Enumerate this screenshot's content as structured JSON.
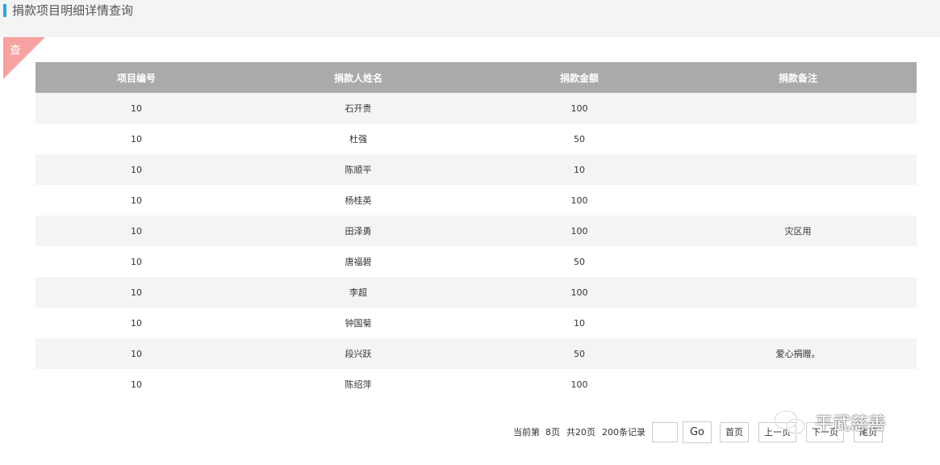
{
  "header": {
    "title": "捐款项目明细详情查询"
  },
  "panel": {
    "corner_label": "查"
  },
  "table": {
    "columns": [
      "项目编号",
      "捐款人姓名",
      "捐款金额",
      "捐款备注"
    ],
    "rows": [
      [
        "10",
        "石开贵",
        "100",
        ""
      ],
      [
        "10",
        "杜强",
        "50",
        ""
      ],
      [
        "10",
        "陈顺平",
        "10",
        ""
      ],
      [
        "10",
        "杨桂英",
        "100",
        ""
      ],
      [
        "10",
        "田泽勇",
        "100",
        "灾区用"
      ],
      [
        "10",
        "唐福碧",
        "50",
        ""
      ],
      [
        "10",
        "李超",
        "100",
        ""
      ],
      [
        "10",
        "钟国菊",
        "10",
        ""
      ],
      [
        "10",
        "段兴跃",
        "50",
        "爱心捐赠。"
      ],
      [
        "10",
        "陈绍萍",
        "100",
        ""
      ]
    ]
  },
  "pager": {
    "current_page_text": "当前第  8页",
    "total_pages_text": "共20页",
    "records_text": "200条记录",
    "page_input_value": "",
    "go_label": "Go",
    "first_label": "首页",
    "prev_label": "上一页",
    "next_label": "下一页",
    "last_label": "尾页"
  },
  "watermark": {
    "text": "平武慈善",
    "icon": "wechat-icon"
  },
  "colors": {
    "accent": "#29a7d8",
    "header_bg": "#aaaaaa",
    "corner": "#f7a1a1",
    "stripe": "#f4f4f4"
  }
}
